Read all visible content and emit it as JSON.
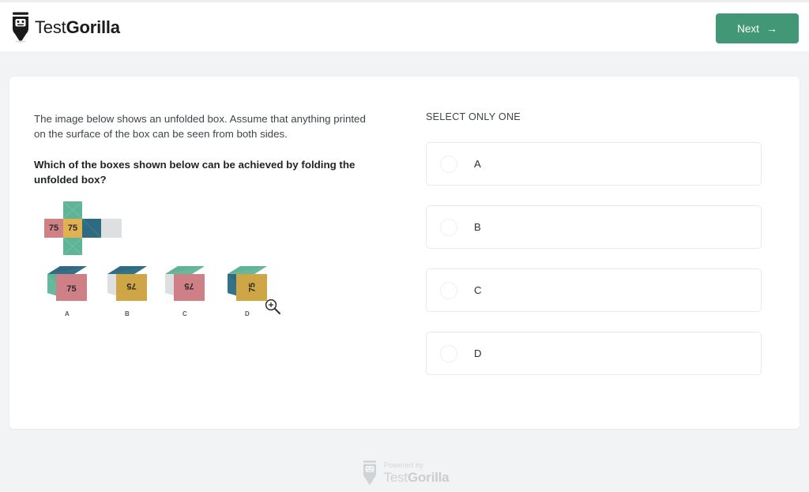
{
  "header": {
    "logo_name": "gorilla-logo-icon",
    "brand_light": "Test",
    "brand_bold": "Gorilla",
    "next_label": "Next",
    "next_arrow": "→",
    "next_color": "#429777"
  },
  "question": {
    "intro": "The image below shows an unfolded box. Assume that anything printed on the surface of the box can be seen from both sides.",
    "prompt": "Which of the boxes shown below can be achieved by folding the unfolded box?",
    "figure": {
      "net_label": "unfolded-box-net",
      "printed_value": "75",
      "colors": {
        "pink": "#d08186",
        "gold": "#e0b252",
        "green": "#5fb396",
        "blue": "#2e6b82",
        "gray": "#dedfe1"
      },
      "cells": [
        {
          "name": "left-face",
          "color": "#d08186",
          "text": "75"
        },
        {
          "name": "front-face",
          "color": "#e0b252",
          "text": "75"
        },
        {
          "name": "right-face",
          "color": "#2e6b82",
          "text": ""
        },
        {
          "name": "back-face",
          "color": "#dedfe1",
          "text": ""
        },
        {
          "name": "top-face",
          "color": "#5fb396",
          "text": ""
        },
        {
          "name": "bottom-face",
          "color": "#5fb396",
          "text": ""
        }
      ]
    },
    "cubes": [
      {
        "label": "A",
        "top": "#2e6b82",
        "side": "#5fb396",
        "front": "#cf8086",
        "text": "75",
        "transform": "none"
      },
      {
        "label": "B",
        "top": "#2e6b82",
        "side": "#dedfe1",
        "front": "#cfa645",
        "text": "75",
        "transform": "rotate-180"
      },
      {
        "label": "C",
        "top": "#5fb396",
        "side": "#dedfe1",
        "front": "#cf8086",
        "text": "75",
        "transform": "flip-horizontal"
      },
      {
        "label": "D",
        "top": "#5fb396",
        "side": "#2e6b82",
        "front": "#cfa645",
        "text": "75",
        "transform": "rotate-90"
      }
    ],
    "magnifier_icon": "zoom-in-icon"
  },
  "answers": {
    "instruction": "SELECT ONLY ONE",
    "options": [
      {
        "label": "A",
        "selected": false
      },
      {
        "label": "B",
        "selected": false
      },
      {
        "label": "C",
        "selected": false
      },
      {
        "label": "D",
        "selected": false
      }
    ]
  },
  "footer": {
    "powered_by": "Powered by",
    "brand_light": "Test",
    "brand_bold": "Gorilla"
  }
}
